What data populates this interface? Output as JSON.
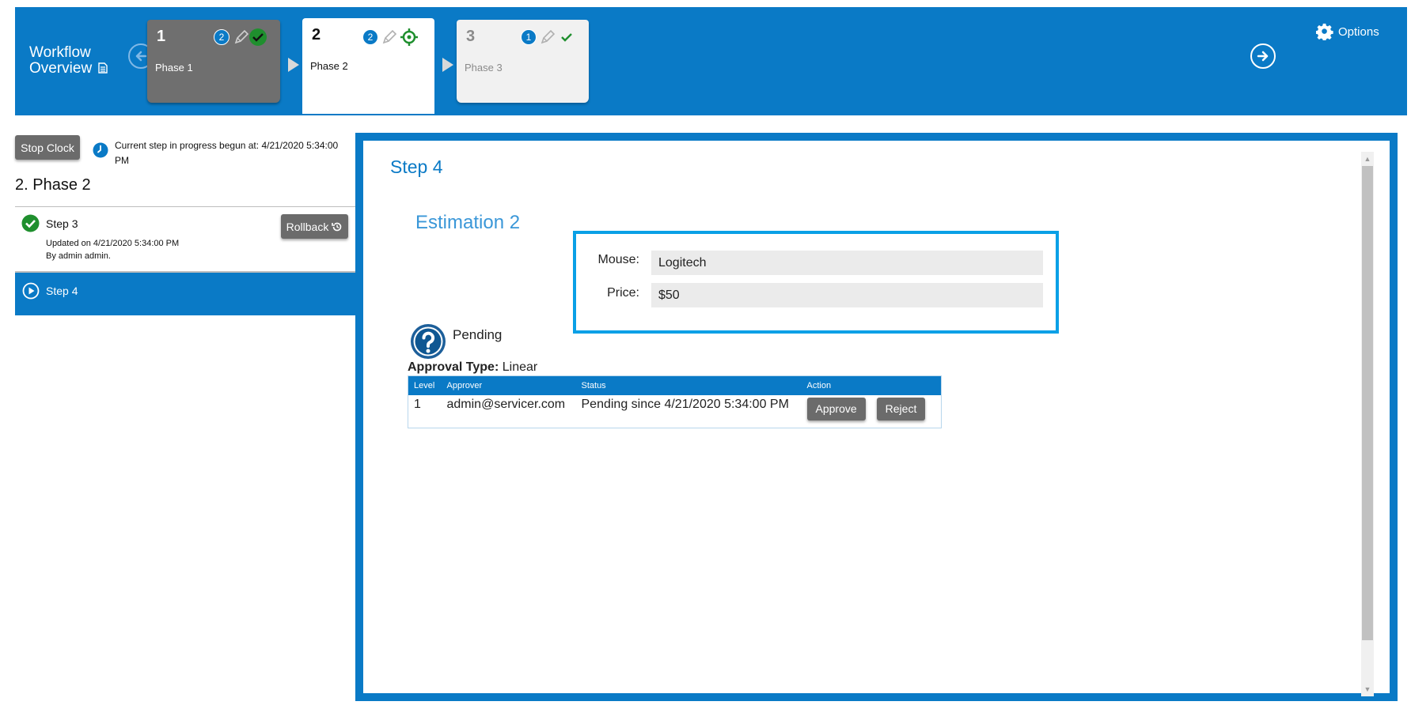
{
  "header": {
    "title_line1": "Workflow",
    "title_line2": "Overview",
    "options_label": "Options",
    "phases": [
      {
        "number": "1",
        "name": "Phase 1",
        "badge": "2",
        "status": "completed"
      },
      {
        "number": "2",
        "name": "Phase 2",
        "badge": "2",
        "status": "current"
      },
      {
        "number": "3",
        "name": "Phase 3",
        "badge": "1",
        "status": "upcoming"
      }
    ]
  },
  "sidebar": {
    "stop_clock_label": "Stop Clock",
    "clock_text": "Current step in progress begun at: 4/21/2020 5:34:00 PM",
    "phase_heading": "2. Phase 2",
    "steps": [
      {
        "label": "Step 3",
        "updated": "Updated on 4/21/2020 5:34:00 PM",
        "by": "By admin admin.",
        "rollback_label": "Rollback",
        "status": "completed"
      },
      {
        "label": "Step 4",
        "status": "in-progress"
      }
    ]
  },
  "main": {
    "step_title": "Step 4",
    "section_title": "Estimation 2",
    "fields": [
      {
        "label": "Mouse:",
        "value": "Logitech"
      },
      {
        "label": "Price:",
        "value": "$50"
      }
    ],
    "approval": {
      "status": "Pending",
      "type_label": "Approval Type:",
      "type_value": "Linear",
      "columns": [
        "Level",
        "Approver",
        "Status",
        "Action"
      ],
      "rows": [
        {
          "level": "1",
          "approver": "admin@servicer.com",
          "status": "Pending since 4/21/2020 5:34:00 PM",
          "approve_label": "Approve",
          "reject_label": "Reject"
        }
      ]
    }
  },
  "colors": {
    "primary": "#0a7ac6",
    "highlight_border": "#0aa0e6",
    "button_gray": "#6b6b6b",
    "success_green": "#1f8f2e"
  }
}
